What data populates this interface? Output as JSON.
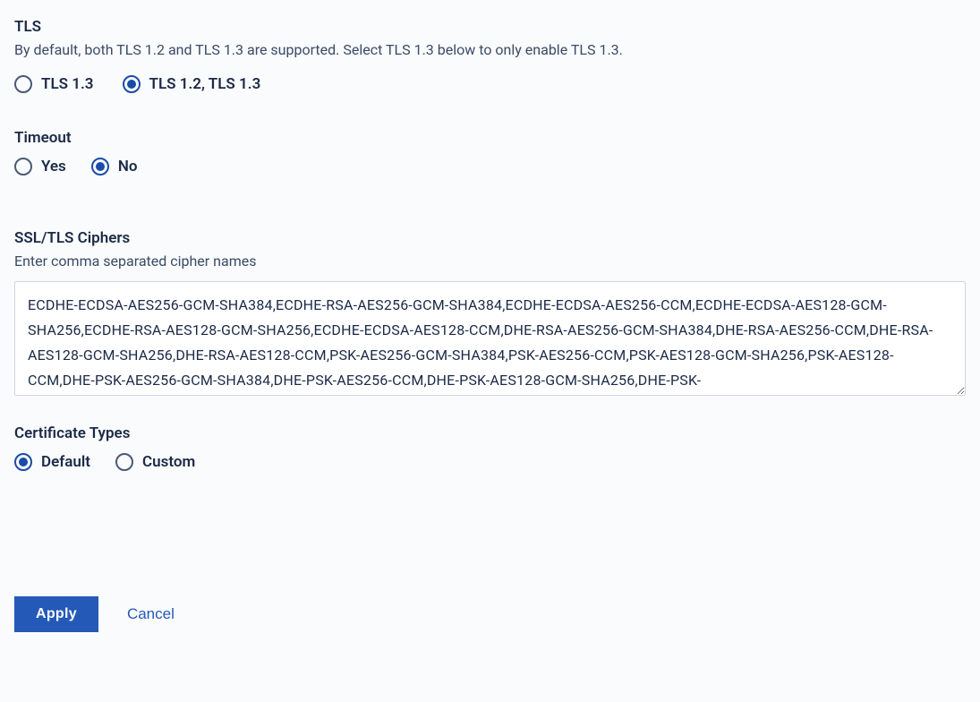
{
  "tls": {
    "title": "TLS",
    "description": "By default, both TLS 1.2 and TLS 1.3 are supported. Select TLS 1.3 below to only enable TLS 1.3.",
    "options": {
      "tls13": "TLS 1.3",
      "tls1213": "TLS 1.2, TLS 1.3"
    },
    "selected": "tls1213"
  },
  "timeout": {
    "title": "Timeout",
    "options": {
      "yes": "Yes",
      "no": "No"
    },
    "selected": "no"
  },
  "ciphers": {
    "title": "SSL/TLS Ciphers",
    "description": "Enter comma separated cipher names",
    "value": "ECDHE-ECDSA-AES256-GCM-SHA384,ECDHE-RSA-AES256-GCM-SHA384,ECDHE-ECDSA-AES256-CCM,ECDHE-ECDSA-AES128-GCM-SHA256,ECDHE-RSA-AES128-GCM-SHA256,ECDHE-ECDSA-AES128-CCM,DHE-RSA-AES256-GCM-SHA384,DHE-RSA-AES256-CCM,DHE-RSA-AES128-GCM-SHA256,DHE-RSA-AES128-CCM,PSK-AES256-GCM-SHA384,PSK-AES256-CCM,PSK-AES128-GCM-SHA256,PSK-AES128-CCM,DHE-PSK-AES256-GCM-SHA384,DHE-PSK-AES256-CCM,DHE-PSK-AES128-GCM-SHA256,DHE-PSK-"
  },
  "cert": {
    "title": "Certificate Types",
    "options": {
      "default": "Default",
      "custom": "Custom"
    },
    "selected": "default"
  },
  "actions": {
    "apply": "Apply",
    "cancel": "Cancel"
  }
}
